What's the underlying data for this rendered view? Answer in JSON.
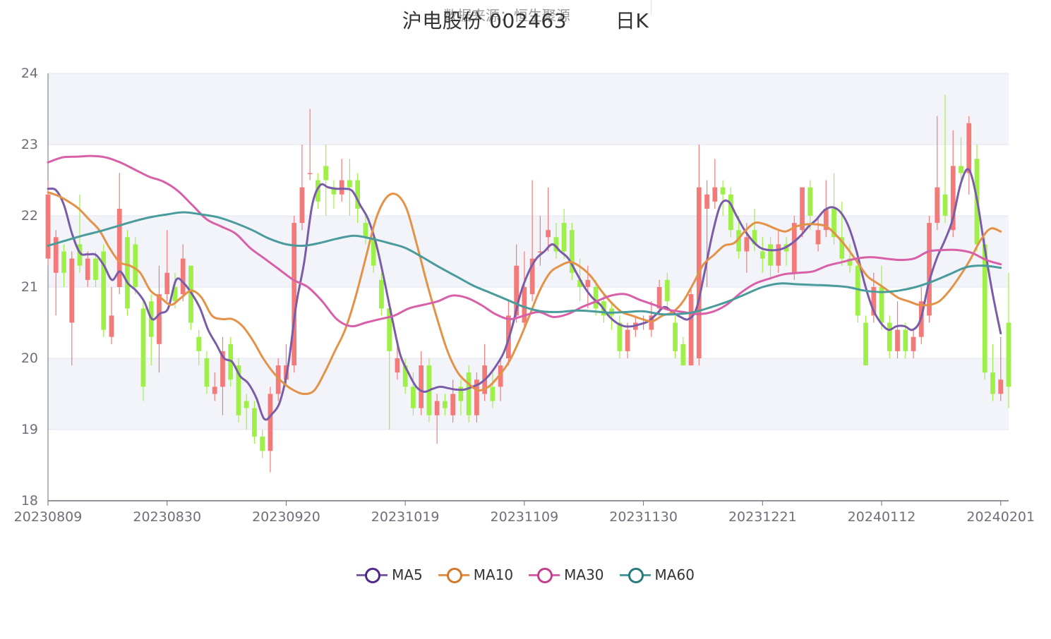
{
  "title": {
    "stock": "沪电股份 002463",
    "period": "日K",
    "source": "数据来源：恒生聚源"
  },
  "colors": {
    "up": "#f47a7a",
    "down": "#9ef048",
    "ma5": "#7a5ca8",
    "ma10": "#e39248",
    "ma30": "#d860a8",
    "ma60": "#4a9b9b",
    "band": "#f3f4fa",
    "grid": "#e0e6f1",
    "axis": "#6e7079"
  },
  "legend": [
    {
      "label": "MA5",
      "color": "#7a5ca8",
      "ring": "#4b2a8a"
    },
    {
      "label": "MA10",
      "color": "#e39248",
      "ring": "#d2782a"
    },
    {
      "label": "MA30",
      "color": "#d860a8",
      "ring": "#c43e8e"
    },
    {
      "label": "MA60",
      "color": "#4a9b9b",
      "ring": "#2a7a7a"
    }
  ],
  "chart_data": {
    "type": "candlestick",
    "title": "沪电股份 002463 日K",
    "ylim": [
      18,
      24
    ],
    "yticks": [
      18,
      19,
      20,
      21,
      22,
      23,
      24
    ],
    "x_tick_labels": [
      "20230809",
      "20230830",
      "20230920",
      "20231019",
      "20231109",
      "20231130",
      "20231221",
      "20240112",
      "20240201"
    ],
    "x_tick_indices": [
      0,
      15,
      30,
      45,
      60,
      75,
      90,
      105,
      120
    ],
    "candles": [
      [
        21.4,
        22.3,
        22.5,
        21.3
      ],
      [
        21.2,
        21.7,
        21.8,
        20.6
      ],
      [
        21.5,
        21.2,
        21.6,
        21.0
      ],
      [
        20.5,
        21.4,
        21.5,
        19.9
      ],
      [
        21.6,
        21.3,
        22.3,
        21.2
      ],
      [
        21.1,
        21.4,
        21.5,
        21.0
      ],
      [
        21.4,
        21.1,
        21.5,
        21.0
      ],
      [
        21.5,
        20.4,
        21.6,
        20.3
      ],
      [
        20.3,
        20.6,
        21.0,
        20.2
      ],
      [
        21.0,
        22.1,
        22.6,
        20.9
      ],
      [
        21.7,
        20.7,
        21.8,
        20.6
      ],
      [
        21.6,
        21.0,
        21.7,
        20.9
      ],
      [
        20.7,
        19.6,
        20.8,
        19.4
      ],
      [
        20.8,
        20.3,
        20.9,
        19.9
      ],
      [
        20.2,
        20.9,
        21.3,
        19.8
      ],
      [
        20.9,
        21.2,
        21.8,
        20.8
      ],
      [
        21.0,
        20.8,
        21.2,
        20.7
      ],
      [
        20.9,
        21.4,
        21.6,
        20.8
      ],
      [
        21.3,
        20.5,
        21.3,
        20.4
      ],
      [
        20.3,
        20.1,
        20.4,
        19.9
      ],
      [
        20.0,
        19.6,
        20.1,
        19.5
      ],
      [
        19.5,
        19.6,
        19.8,
        19.4
      ],
      [
        19.6,
        20.1,
        20.3,
        19.2
      ],
      [
        20.2,
        19.7,
        20.3,
        19.6
      ],
      [
        19.9,
        19.2,
        20.0,
        19.1
      ],
      [
        19.4,
        19.3,
        19.5,
        19.0
      ],
      [
        19.3,
        18.9,
        19.4,
        18.8
      ],
      [
        18.9,
        18.7,
        19.0,
        18.6
      ],
      [
        18.7,
        19.5,
        19.6,
        18.4
      ],
      [
        19.5,
        19.9,
        20.0,
        19.4
      ],
      [
        19.7,
        19.9,
        20.2,
        19.6
      ],
      [
        19.9,
        21.9,
        22.0,
        19.8
      ],
      [
        21.9,
        22.4,
        23.0,
        21.8
      ],
      [
        22.6,
        22.6,
        23.5,
        22.5
      ],
      [
        22.5,
        22.2,
        22.6,
        22.1
      ],
      [
        22.7,
        22.5,
        23.0,
        22.0
      ],
      [
        22.4,
        22.3,
        22.5,
        22.1
      ],
      [
        22.3,
        22.5,
        22.8,
        22.2
      ],
      [
        22.5,
        22.4,
        22.8,
        22.0
      ],
      [
        22.5,
        22.1,
        22.6,
        21.9
      ],
      [
        21.9,
        21.7,
        22.0,
        21.6
      ],
      [
        21.7,
        21.3,
        21.8,
        21.2
      ],
      [
        21.1,
        20.7,
        21.2,
        20.6
      ],
      [
        20.7,
        20.1,
        20.8,
        19.0
      ],
      [
        19.8,
        20.0,
        20.2,
        19.7
      ],
      [
        19.9,
        19.6,
        20.0,
        19.5
      ],
      [
        19.6,
        19.3,
        19.8,
        19.2
      ],
      [
        19.3,
        19.9,
        20.1,
        19.2
      ],
      [
        19.9,
        19.2,
        20.0,
        19.1
      ],
      [
        19.2,
        19.4,
        19.5,
        18.8
      ],
      [
        19.4,
        19.3,
        19.5,
        19.2
      ],
      [
        19.2,
        19.5,
        19.7,
        19.1
      ],
      [
        19.6,
        19.4,
        19.7,
        19.2
      ],
      [
        19.8,
        19.2,
        19.9,
        19.1
      ],
      [
        19.2,
        19.7,
        19.8,
        19.1
      ],
      [
        19.5,
        19.9,
        20.2,
        19.4
      ],
      [
        19.6,
        19.4,
        19.8,
        19.3
      ],
      [
        19.6,
        19.9,
        20.0,
        19.4
      ],
      [
        20.0,
        20.6,
        20.8,
        19.9
      ],
      [
        20.6,
        21.3,
        21.6,
        20.5
      ],
      [
        20.5,
        21.0,
        21.5,
        20.4
      ],
      [
        20.9,
        21.4,
        22.5,
        20.8
      ],
      [
        21.5,
        21.5,
        22.0,
        21.3
      ],
      [
        21.7,
        21.8,
        22.4,
        21.5
      ],
      [
        21.7,
        21.5,
        21.9,
        21.4
      ],
      [
        21.9,
        21.5,
        22.1,
        21.4
      ],
      [
        21.8,
        21.2,
        21.9,
        21.1
      ],
      [
        21.1,
        21.0,
        21.4,
        20.8
      ],
      [
        21.0,
        21.1,
        21.3,
        20.7
      ],
      [
        21.0,
        20.7,
        21.1,
        20.6
      ],
      [
        20.8,
        20.6,
        20.9,
        20.5
      ],
      [
        20.7,
        20.6,
        20.8,
        20.4
      ],
      [
        20.5,
        20.1,
        20.6,
        20.0
      ],
      [
        20.1,
        20.4,
        20.5,
        20.0
      ],
      [
        20.4,
        20.5,
        20.6,
        20.3
      ],
      [
        20.5,
        20.5,
        20.6,
        20.4
      ],
      [
        20.4,
        20.6,
        20.8,
        20.3
      ],
      [
        20.7,
        21.0,
        21.1,
        20.6
      ],
      [
        21.1,
        20.8,
        21.2,
        20.7
      ],
      [
        20.5,
        20.1,
        20.6,
        20.0
      ],
      [
        20.2,
        19.9,
        20.3,
        19.9
      ],
      [
        19.9,
        20.9,
        21.0,
        19.9
      ],
      [
        20.0,
        22.4,
        23.0,
        19.9
      ],
      [
        22.1,
        22.3,
        22.5,
        21.0
      ],
      [
        22.2,
        22.4,
        22.8,
        22.1
      ],
      [
        22.4,
        22.3,
        22.5,
        22.0
      ],
      [
        22.3,
        21.8,
        22.4,
        21.7
      ],
      [
        21.8,
        21.5,
        22.0,
        21.4
      ],
      [
        21.5,
        21.7,
        21.9,
        21.2
      ],
      [
        21.8,
        21.6,
        22.1,
        21.5
      ],
      [
        21.5,
        21.4,
        21.7,
        21.2
      ],
      [
        21.6,
        21.3,
        21.7,
        21.1
      ],
      [
        21.3,
        21.6,
        21.8,
        21.2
      ],
      [
        21.6,
        21.5,
        21.7,
        21.3
      ],
      [
        21.2,
        21.9,
        22.0,
        21.1
      ],
      [
        21.8,
        22.4,
        22.4,
        21.7
      ],
      [
        22.4,
        22.0,
        22.5,
        21.8
      ],
      [
        21.6,
        21.8,
        22.0,
        21.5
      ],
      [
        21.8,
        22.1,
        22.5,
        21.7
      ],
      [
        22.1,
        21.7,
        22.6,
        21.6
      ],
      [
        21.7,
        21.4,
        22.2,
        21.3
      ],
      [
        21.4,
        21.3,
        21.6,
        21.2
      ],
      [
        21.3,
        20.6,
        21.5,
        20.5
      ],
      [
        20.5,
        19.9,
        20.6,
        19.9
      ],
      [
        20.6,
        21.0,
        21.2,
        20.5
      ],
      [
        21.0,
        20.5,
        21.3,
        20.4
      ],
      [
        20.5,
        20.1,
        20.6,
        20.0
      ],
      [
        20.1,
        20.4,
        20.8,
        20.0
      ],
      [
        20.4,
        20.1,
        20.5,
        20.0
      ],
      [
        20.1,
        20.3,
        20.4,
        20.0
      ],
      [
        20.3,
        20.8,
        21.0,
        20.2
      ],
      [
        20.6,
        21.9,
        22.0,
        20.5
      ],
      [
        21.9,
        22.4,
        23.4,
        21.8
      ],
      [
        22.3,
        22.0,
        23.7,
        21.9
      ],
      [
        21.8,
        22.7,
        23.2,
        21.7
      ],
      [
        22.7,
        22.6,
        23.1,
        22.4
      ],
      [
        22.6,
        23.3,
        23.4,
        22.3
      ],
      [
        22.8,
        21.6,
        23.0,
        21.5
      ],
      [
        21.6,
        19.8,
        21.7,
        19.7
      ],
      [
        19.8,
        19.5,
        20.2,
        19.4
      ],
      [
        19.5,
        19.7,
        20.3,
        19.4
      ],
      [
        20.5,
        19.6,
        21.2,
        19.3
      ]
    ],
    "series": [
      {
        "name": "MA5",
        "values": [
          22.38,
          22.36,
          22.15,
          21.75,
          21.48,
          21.46,
          21.45,
          21.3,
          21.1,
          21.22,
          21.05,
          20.95,
          20.8,
          20.55,
          20.63,
          20.7,
          21.1,
          21.05,
          20.9,
          20.7,
          20.4,
          20.2,
          20.0,
          19.95,
          19.75,
          19.65,
          19.45,
          19.15,
          19.22,
          19.4,
          19.9,
          20.75,
          21.35,
          22.15,
          22.43,
          22.4,
          22.38,
          22.38,
          22.35,
          22.15,
          21.95,
          21.6,
          21.1,
          20.55,
          20.05,
          19.8,
          19.6,
          19.53,
          19.57,
          19.6,
          19.58,
          19.56,
          19.56,
          19.6,
          19.65,
          19.75,
          19.9,
          20.1,
          20.45,
          20.9,
          21.2,
          21.4,
          21.5,
          21.6,
          21.5,
          21.4,
          21.2,
          21.0,
          20.85,
          20.75,
          20.6,
          20.5,
          20.45,
          20.45,
          20.48,
          20.52,
          20.62,
          20.72,
          20.65,
          20.58,
          20.55,
          20.7,
          21.2,
          21.75,
          22.15,
          22.2,
          22.0,
          21.8,
          21.65,
          21.55,
          21.52,
          21.52,
          21.55,
          21.62,
          21.72,
          21.85,
          21.95,
          22.08,
          22.12,
          22.05,
          21.85,
          21.5,
          21.05,
          20.7,
          20.5,
          20.4,
          20.45,
          20.45,
          20.4,
          20.55,
          21.05,
          21.4,
          21.65,
          21.95,
          22.45,
          22.65,
          22.25,
          21.55,
          20.9,
          20.35
        ]
      },
      {
        "name": "MA10",
        "values": [
          22.33,
          22.28,
          22.2,
          22.1,
          21.95,
          21.8,
          21.55,
          21.35,
          21.3,
          21.2,
          20.95,
          20.85,
          20.75,
          20.85,
          20.95,
          20.85,
          20.6,
          20.55,
          20.55,
          20.45,
          20.25,
          20.0,
          19.8,
          19.65,
          19.55,
          19.5,
          19.55,
          19.8,
          20.1,
          20.4,
          20.85,
          21.4,
          21.95,
          22.25,
          22.3,
          22.1,
          21.6,
          21.05,
          20.55,
          20.1,
          19.8,
          19.65,
          19.55,
          19.6,
          19.75,
          19.95,
          20.25,
          20.6,
          20.95,
          21.2,
          21.3,
          21.35,
          21.28,
          21.15,
          20.95,
          20.78,
          20.65,
          20.6,
          20.55,
          20.52,
          20.6,
          20.65,
          20.8,
          21.05,
          21.32,
          21.45,
          21.58,
          21.62,
          21.78,
          21.9,
          21.88,
          21.82,
          21.78,
          21.85,
          21.88,
          21.88,
          21.85,
          21.72,
          21.55,
          21.35,
          21.15,
          21.05,
          20.95,
          20.85,
          20.8,
          20.75,
          20.75,
          20.8,
          20.95,
          21.15,
          21.38,
          21.65,
          21.82,
          21.78
        ]
      },
      {
        "name": "MA30",
        "values": [
          22.75,
          22.82,
          22.83,
          22.84,
          22.82,
          22.75,
          22.65,
          22.55,
          22.48,
          22.35,
          22.15,
          21.95,
          21.85,
          21.75,
          21.55,
          21.4,
          21.25,
          21.1,
          21.0,
          20.8,
          20.55,
          20.45,
          20.5,
          20.55,
          20.6,
          20.7,
          20.75,
          20.8,
          20.88,
          20.85,
          20.75,
          20.62,
          20.55,
          20.6,
          20.65,
          20.58,
          20.62,
          20.72,
          20.8,
          20.88,
          20.9,
          20.82,
          20.75,
          20.68,
          20.65,
          20.62,
          20.65,
          20.75,
          20.92,
          21.05,
          21.12,
          21.18,
          21.2,
          21.22,
          21.3,
          21.35,
          21.4,
          21.42,
          21.4,
          21.38,
          21.4,
          21.5,
          21.52,
          21.52,
          21.48,
          21.38,
          21.32
        ]
      },
      {
        "name": "MA60",
        "values": [
          21.58,
          21.65,
          21.72,
          21.78,
          21.85,
          21.92,
          21.98,
          22.02,
          22.05,
          22.02,
          21.98,
          21.9,
          21.8,
          21.68,
          21.6,
          21.58,
          21.62,
          21.68,
          21.72,
          21.68,
          21.62,
          21.55,
          21.42,
          21.28,
          21.15,
          21.02,
          20.92,
          20.82,
          20.72,
          20.66,
          20.65,
          20.67,
          20.66,
          20.64,
          20.65,
          20.66,
          20.62,
          20.62,
          20.65,
          20.72,
          20.8,
          20.9,
          21.0,
          21.05,
          21.04,
          21.03,
          21.02,
          21.0,
          20.95,
          20.93,
          20.95,
          21.0,
          21.08,
          21.18,
          21.28,
          21.3,
          21.27
        ]
      }
    ],
    "ma_start": [
      0,
      0,
      0,
      0
    ],
    "ma_end": [
      120,
      120,
      120,
      120
    ]
  }
}
